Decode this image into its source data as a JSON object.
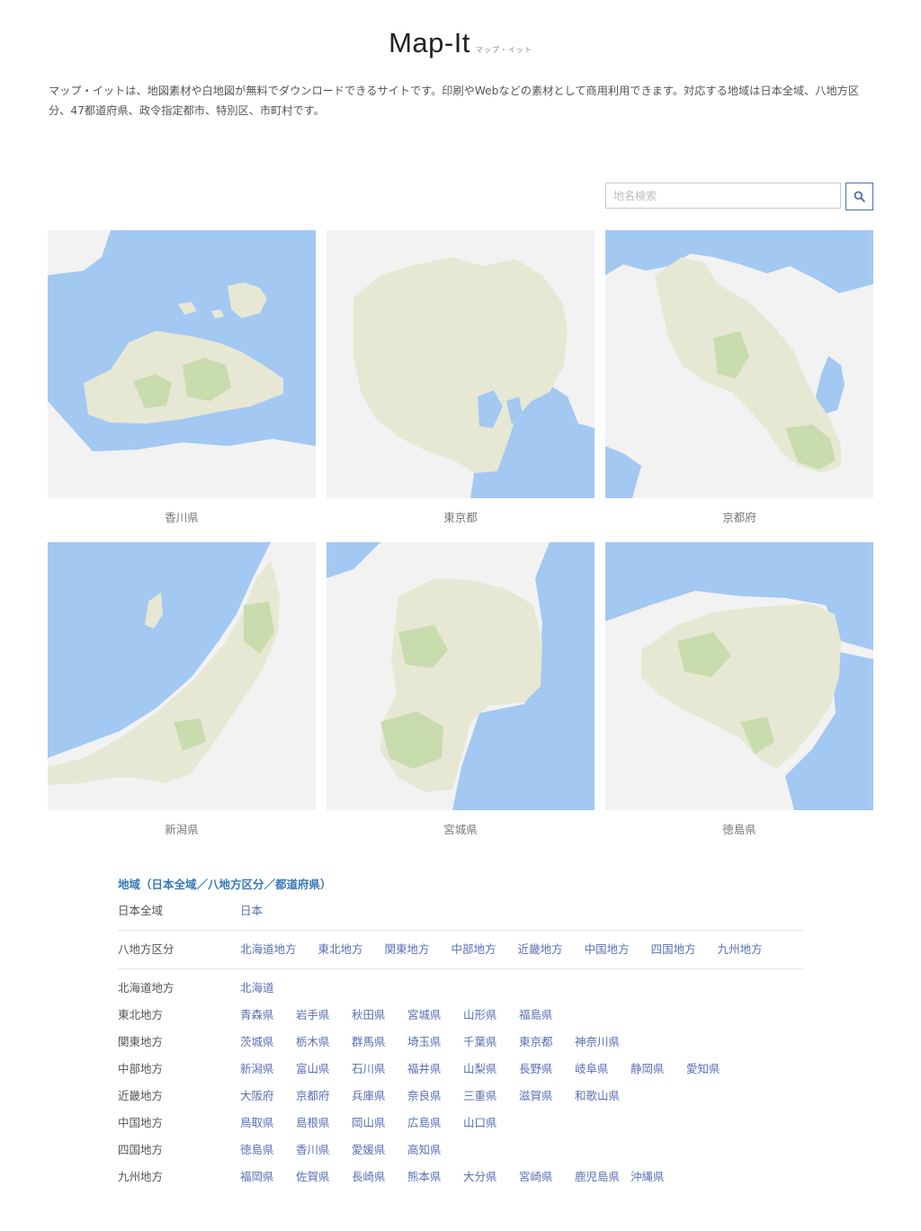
{
  "header": {
    "logo": "Map-It",
    "logo_sub": "マップ・イット"
  },
  "description": "マップ・イットは、地図素材や白地図が無料でダウンロードできるサイトです。印刷やWebなどの素材として商用利用できます。対応する地域は日本全域、八地方区分、47都道府県、政令指定都市、特別区、市町村です。",
  "search": {
    "placeholder": "地名検索",
    "icon": "search-icon"
  },
  "maps": [
    {
      "name": "香川県"
    },
    {
      "name": "東京都"
    },
    {
      "name": "京都府"
    },
    {
      "name": "新潟県"
    },
    {
      "name": "宮城県"
    },
    {
      "name": "徳島県"
    }
  ],
  "colors": {
    "sea": "#a3c8f2",
    "land": "#e6e8d4",
    "green": "#c8dcae",
    "other_land": "#f2f2f2",
    "link": "#5a6fb5",
    "heading": "#3a78b5"
  },
  "regions": {
    "title": "地域（日本全域／八地方区分／都道府県）",
    "all_japan": {
      "label": "日本全域",
      "links": [
        "日本"
      ]
    },
    "eight_regions": {
      "label": "八地方区分",
      "links": [
        "北海道地方",
        "東北地方",
        "関東地方",
        "中部地方",
        "近畿地方",
        "中国地方",
        "四国地方",
        "九州地方"
      ]
    },
    "prefectures": [
      {
        "label": "北海道地方",
        "links": [
          "北海道"
        ]
      },
      {
        "label": "東北地方",
        "links": [
          "青森県",
          "岩手県",
          "秋田県",
          "宮城県",
          "山形県",
          "福島県"
        ]
      },
      {
        "label": "関東地方",
        "links": [
          "茨城県",
          "栃木県",
          "群馬県",
          "埼玉県",
          "千葉県",
          "東京都",
          "神奈川県"
        ]
      },
      {
        "label": "中部地方",
        "links": [
          "新潟県",
          "富山県",
          "石川県",
          "福井県",
          "山梨県",
          "長野県",
          "岐阜県",
          "静岡県",
          "愛知県"
        ]
      },
      {
        "label": "近畿地方",
        "links": [
          "大阪府",
          "京都府",
          "兵庫県",
          "奈良県",
          "三重県",
          "滋賀県",
          "和歌山県"
        ]
      },
      {
        "label": "中国地方",
        "links": [
          "鳥取県",
          "島根県",
          "岡山県",
          "広島県",
          "山口県"
        ]
      },
      {
        "label": "四国地方",
        "links": [
          "徳島県",
          "香川県",
          "愛媛県",
          "高知県"
        ]
      },
      {
        "label": "九州地方",
        "links": [
          "福岡県",
          "佐賀県",
          "長崎県",
          "熊本県",
          "大分県",
          "宮崎県",
          "鹿児島県",
          "沖縄県"
        ]
      }
    ]
  }
}
